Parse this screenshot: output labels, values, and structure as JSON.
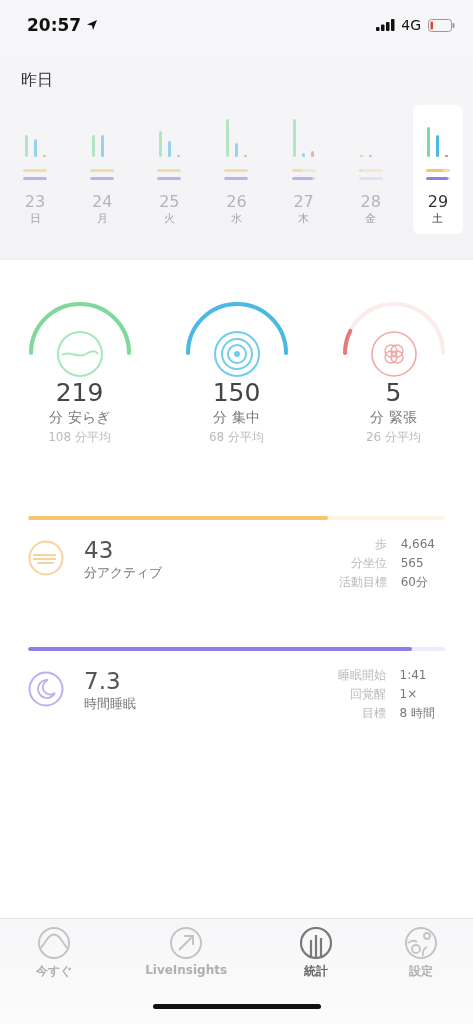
{
  "status_bar": {
    "time": "20:57",
    "network": "4G"
  },
  "header": {
    "title": "昨日"
  },
  "days": [
    {
      "date": "23",
      "weekday": "日",
      "selected": false,
      "activity": {
        "level": 1
      },
      "sleep": {
        "level": 1
      }
    },
    {
      "date": "24",
      "weekday": "月",
      "selected": false,
      "activity": {
        "level": 1
      },
      "sleep": {
        "level": 1
      }
    },
    {
      "date": "25",
      "weekday": "火",
      "selected": false,
      "activity": {
        "level": 1
      },
      "sleep": {
        "level": 1
      }
    },
    {
      "date": "26",
      "weekday": "水",
      "selected": false,
      "activity": {
        "level": 1
      },
      "sleep": {
        "level": 1
      }
    },
    {
      "date": "27",
      "weekday": "木",
      "selected": false,
      "activity": {
        "level": 0.45
      },
      "sleep": {
        "level": 0.9
      }
    },
    {
      "date": "28",
      "weekday": "金",
      "selected": false,
      "activity": {
        "level": 0.12
      },
      "sleep": {
        "level": 0
      }
    },
    {
      "date": "29",
      "weekday": "土",
      "selected": true,
      "activity": {
        "level": 0.7
      },
      "sleep": {
        "level": 0.92
      }
    }
  ],
  "gauges": [
    {
      "kind": "calm",
      "value": "219",
      "label": "分 安らぎ",
      "average": "108 分平均"
    },
    {
      "kind": "focus",
      "value": "150",
      "label": "分 集中",
      "average": "68 分平均"
    },
    {
      "kind": "tense",
      "value": "5",
      "label": "分 緊張",
      "average": "26 分平均"
    }
  ],
  "summaries": [
    {
      "kind": "activity",
      "level": 0.72,
      "value": "43",
      "label": "分アクティブ",
      "details": [
        {
          "name": "歩",
          "value": "4,664"
        },
        {
          "name": "分坐位",
          "value": "565"
        },
        {
          "name": "活動目標",
          "value": "60分"
        }
      ]
    },
    {
      "kind": "sleep",
      "level": 0.92,
      "value": "7.3",
      "label": "時間睡眠",
      "details": [
        {
          "name": "睡眠開始",
          "value": "1:41"
        },
        {
          "name": "回覚醒",
          "value": "1×"
        },
        {
          "name": "目標",
          "value": "8 時間"
        }
      ]
    }
  ],
  "tab_bar": [
    {
      "kind": "now",
      "label": "今すぐ",
      "selected": false
    },
    {
      "kind": "insights",
      "label": "LiveInsights",
      "selected": false
    },
    {
      "kind": "stats",
      "label": "統計",
      "selected": true
    },
    {
      "kind": "settings",
      "label": "設定",
      "selected": false
    }
  ]
}
